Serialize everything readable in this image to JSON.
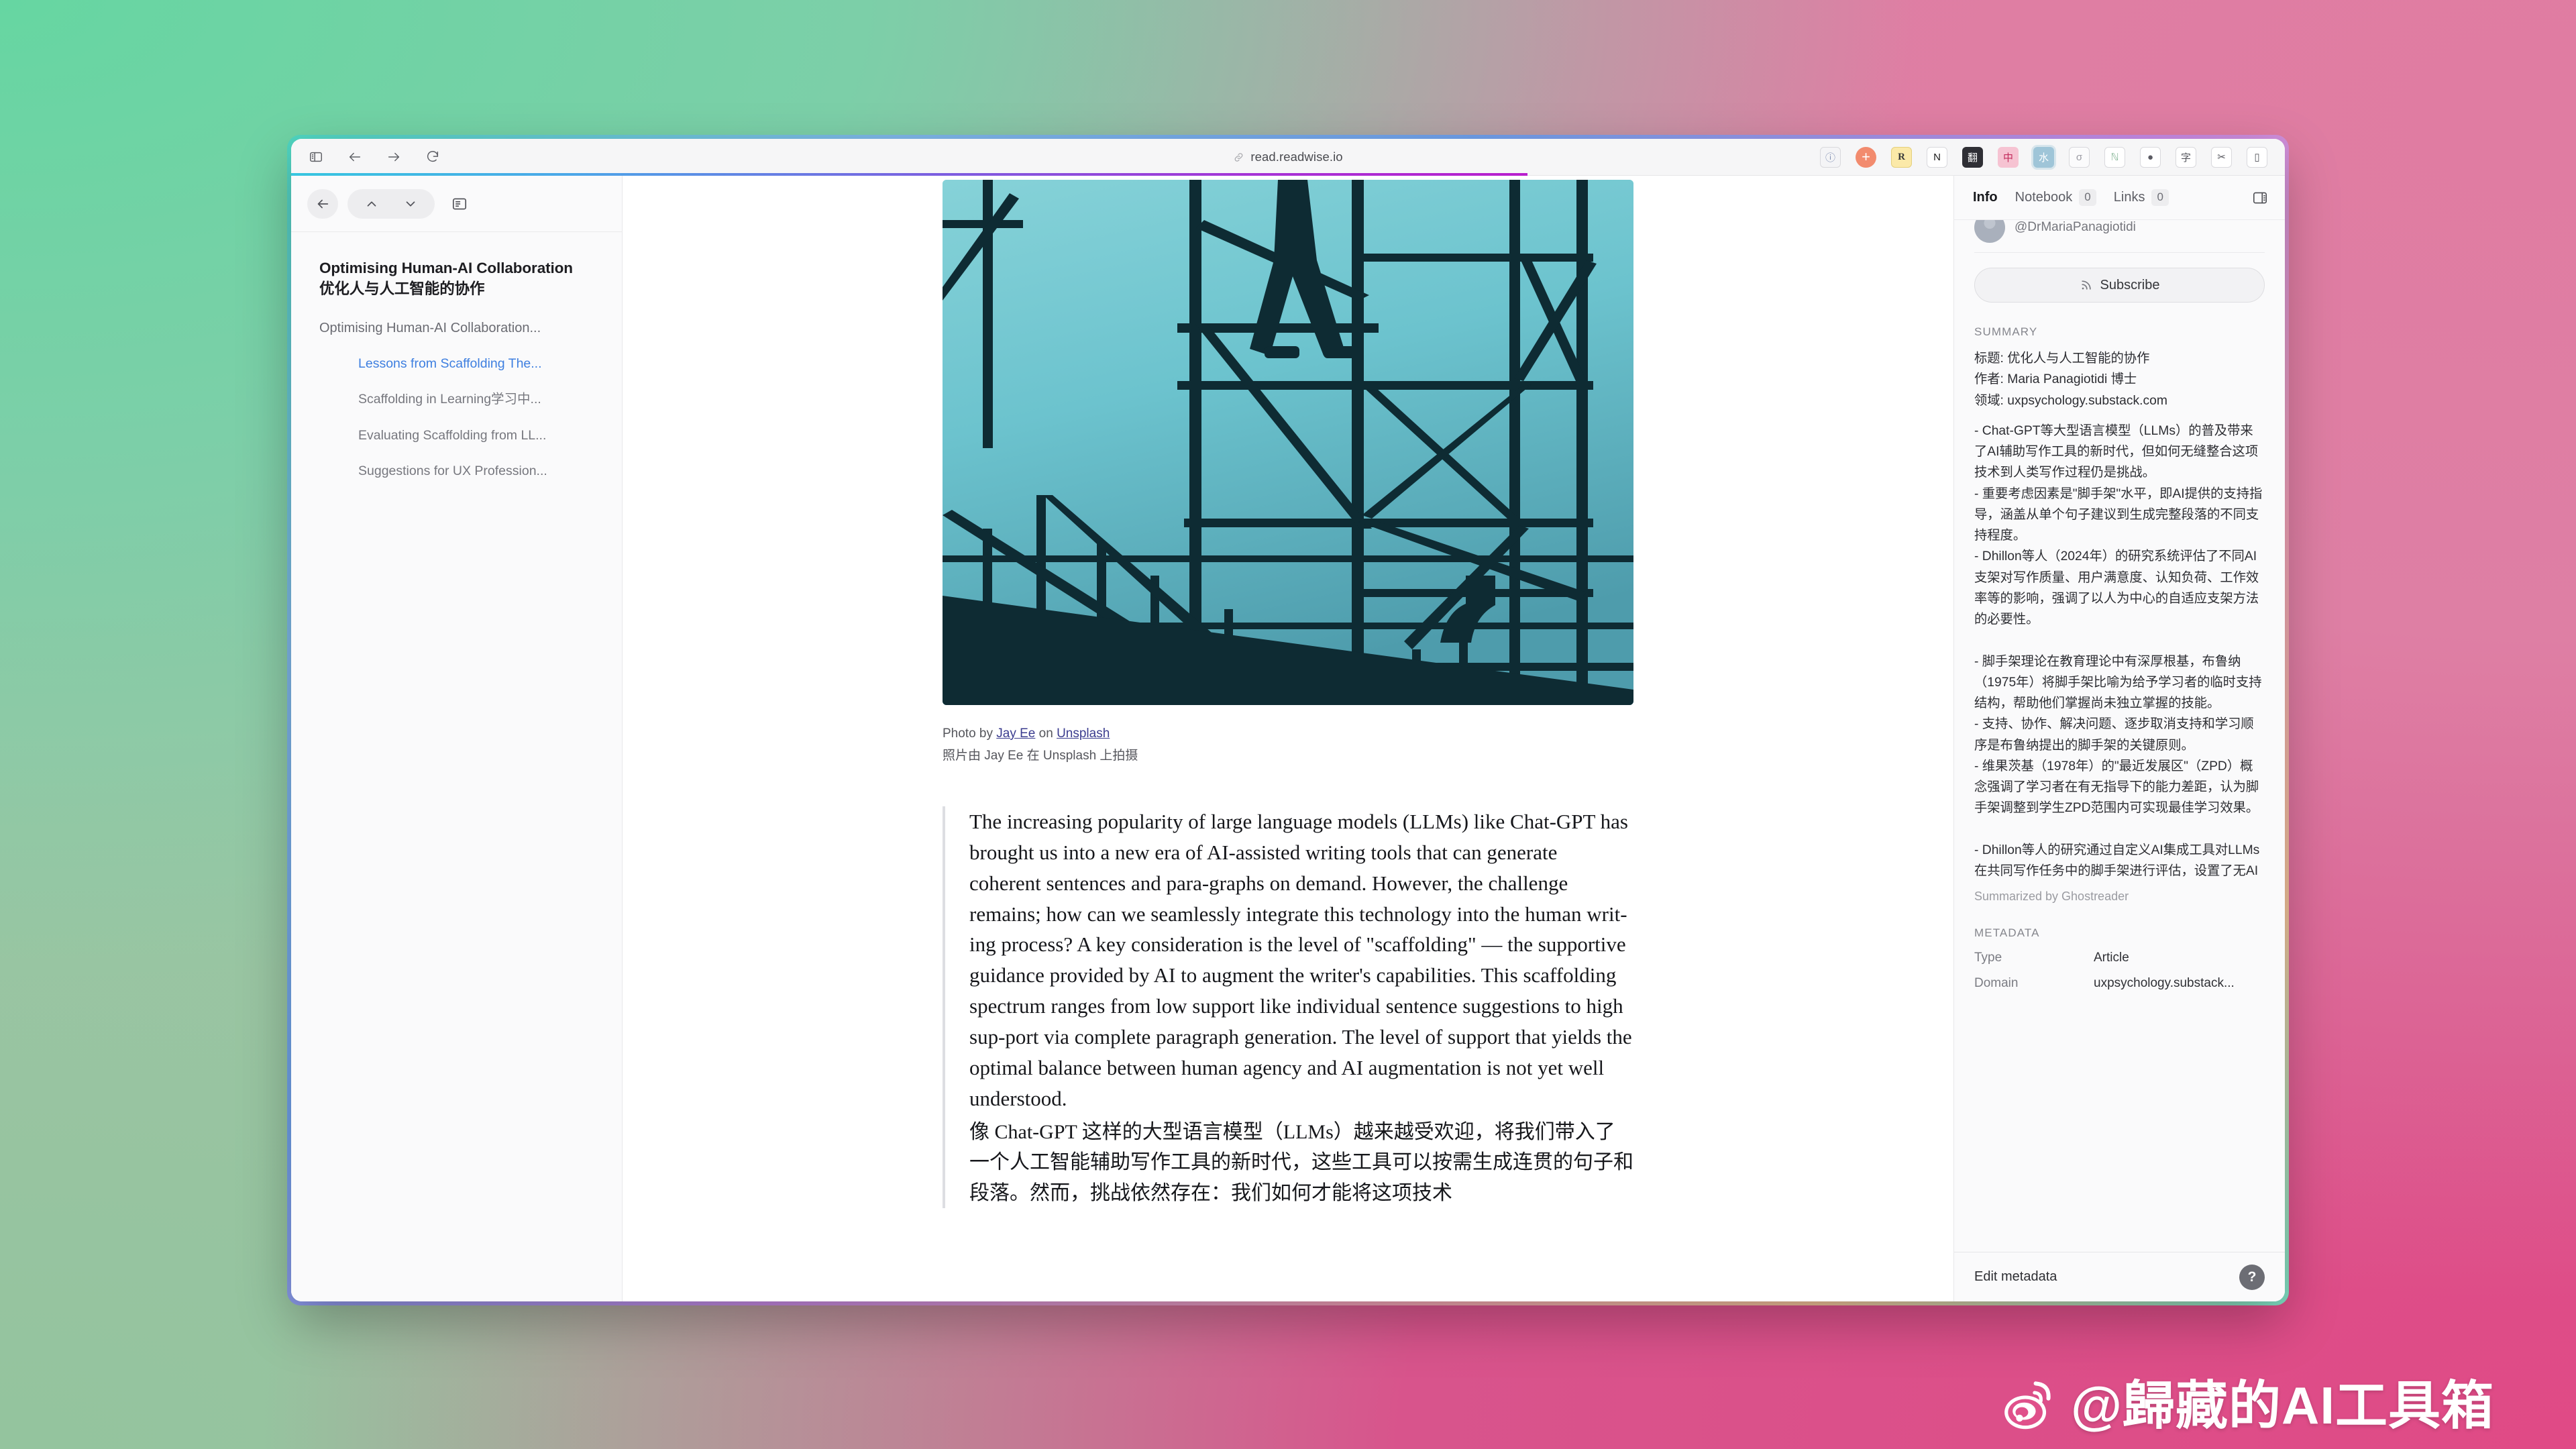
{
  "browser": {
    "url": "read.readwise.io",
    "nav": {
      "sidebar_toggle": "sidebar-toggle",
      "back": "back",
      "forward": "forward",
      "reload": "reload"
    },
    "extensions": [
      {
        "name": "privacy-badger-extension",
        "glyph": "ⓘ",
        "bg": "#F4F4F6",
        "fg": "#7f8eb2"
      },
      {
        "name": "add-extension",
        "glyph": "+",
        "bg": "#F28B6E",
        "fg": "#ffffff"
      },
      {
        "name": "readwise-extension",
        "glyph": "R",
        "bg": "#FBE9A8",
        "fg": "#3a3a3a"
      },
      {
        "name": "notion-extension",
        "glyph": "N",
        "bg": "#FFFFFF",
        "fg": "#1a1a1a"
      },
      {
        "name": "translate-extension",
        "glyph": "翻",
        "bg": "#2f2f35",
        "fg": "#ffffff"
      },
      {
        "name": "chinese-english-extension",
        "glyph": "中",
        "bg": "#F6C3D2",
        "fg": "#c22b5c"
      },
      {
        "name": "immersive-translate-extension",
        "glyph": "水",
        "bg": "#9FC5D8",
        "fg": "#ffffff"
      },
      {
        "name": "sigma-extension",
        "glyph": "σ",
        "bg": "#FBFBFC",
        "fg": "#9a9aa2"
      },
      {
        "name": "notability-extension",
        "glyph": "ℕ",
        "bg": "#FFFFFF",
        "fg": "#8ab89a"
      },
      {
        "name": "profile-avatar-extension",
        "glyph": "●",
        "bg": "#FFFFFF",
        "fg": "#5a5a62"
      },
      {
        "name": "dictionary-extension",
        "glyph": "字",
        "bg": "#FFFFFF",
        "fg": "#55565d"
      },
      {
        "name": "share-extension",
        "glyph": "✂",
        "bg": "#FFFFFF",
        "fg": "#55565d"
      },
      {
        "name": "split-view-extension",
        "glyph": "▯",
        "bg": "#FFFFFF",
        "fg": "#55565d"
      }
    ]
  },
  "sidebar": {
    "header_buttons": [
      "back-arrow",
      "chevron-up",
      "chevron-down",
      "document-outline"
    ],
    "doc_title_en": "Optimising Human-AI Collaboration",
    "doc_title_cn": "优化人与人工智能的协作",
    "toc": [
      {
        "label": "Optimising Human-AI Collaboration...",
        "level": 1,
        "active": false
      },
      {
        "label": "Lessons from Scaffolding The...",
        "level": 2,
        "active": true
      },
      {
        "label": "Scaffolding in Learning学习中...",
        "level": 2,
        "active": false
      },
      {
        "label": "Evaluating Scaffolding from LL...",
        "level": 2,
        "active": false
      },
      {
        "label": "Suggestions for UX Profession...",
        "level": 2,
        "active": false
      }
    ]
  },
  "reader": {
    "hero_alt": "scaffolding-photo",
    "credit_prefix": "Photo by ",
    "credit_author": "Jay Ee",
    "credit_middle": " on ",
    "credit_source": "Unsplash",
    "credit_cn": "照片由 Jay Ee 在 Unsplash 上拍摄",
    "paragraph_en": "The increasing popularity of large language models (LLMs) like Chat-GPT has brought us into a new era of AI-assisted writing tools that can generate coherent sentences and para-graphs on demand. However, the challenge remains; how can we seamlessly integrate this technology into the human writ-ing process? A key consideration is the level of \"scaffolding\" — the supportive guidance provided by AI to augment the writer's capabilities. This scaffolding spectrum ranges from low support like individual sentence suggestions to high sup-port via complete paragraph generation. The level of support that yields the optimal balance between human agency and AI augmentation is not yet well understood.",
    "paragraph_cn": "像 Chat-GPT 这样的大型语言模型（LLMs）越来越受欢迎，将我们带入了一个人工智能辅助写作工具的新时代，这些工具可以按需生成连贯的句子和段落。然而，挑战依然存在：我们如何才能将这项技术"
  },
  "info": {
    "tabs": [
      {
        "label": "Info",
        "count": null,
        "active": true
      },
      {
        "label": "Notebook",
        "count": "0",
        "active": false
      },
      {
        "label": "Links",
        "count": "0",
        "active": false
      }
    ],
    "panel_toggle_icon": "panel-layout-icon",
    "author_handle": "@DrMariaPanagiotidi",
    "subscribe_label": "Subscribe",
    "summary_label": "SUMMARY",
    "summary_head": "标题: 优化人与人工智能的协作\n作者: Maria Panagiotidi 博士\n领域: uxpsychology.substack.com",
    "summary_body": "- Chat-GPT等大型语言模型（LLMs）的普及带来了AI辅助写作工具的新时代，但如何无缝整合这项技术到人类写作过程仍是挑战。\n- 重要考虑因素是\"脚手架\"水平，即AI提供的支持指导，涵盖从单个句子建议到生成完整段落的不同支持程度。\n- Dhillon等人（2024年）的研究系统评估了不同AI支架对写作质量、用户满意度、认知负荷、工作效率等的影响，强调了以人为中心的自适应支架方法的必要性。\n\n- 脚手架理论在教育理论中有深厚根基，布鲁纳（1975年）将脚手架比喻为给予学习者的临时支持结构，帮助他们掌握尚未独立掌握的技能。\n- 支持、协作、解决问题、逐步取消支持和学习顺序是布鲁纳提出的脚手架的关键原则。\n- 维果茨基（1978年）的\"最近发展区\"（ZPD）概念强调了学习者在有无指导下的能力差距，认为脚手架调整到学生ZPD范围内可实现最佳学习效果。\n\n- Dhillon等人的研究通过自定义AI集成工具对LLMs在共同写作任务中的脚手架进行评估，设置了无AI",
    "summarized_by": "Summarized by Ghostreader",
    "metadata_label": "METADATA",
    "metadata": [
      {
        "key": "Type",
        "value": "Article"
      },
      {
        "key": "Domain",
        "value": "uxpsychology.substack..."
      }
    ],
    "edit_metadata_label": "Edit metadata",
    "help_label": "?"
  },
  "watermark": {
    "text": "@歸藏的AI工具箱",
    "logo": "weibo-logo"
  }
}
